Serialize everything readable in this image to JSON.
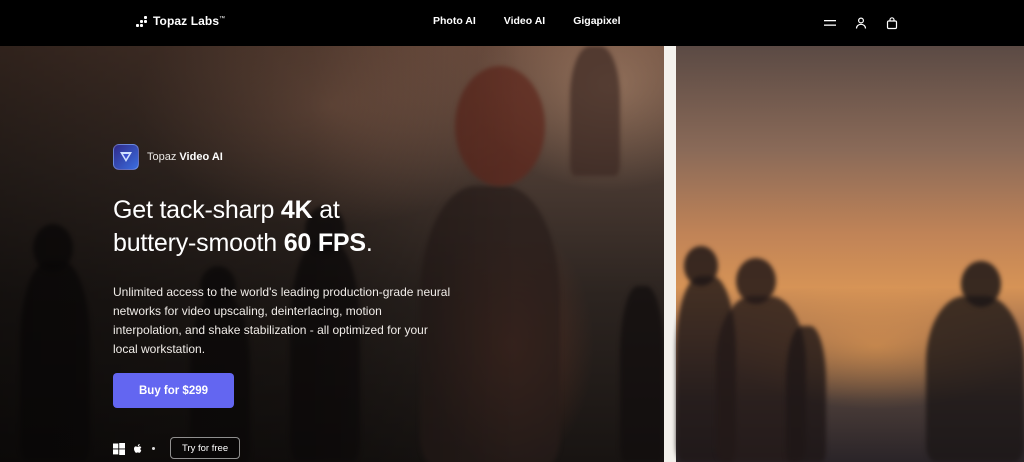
{
  "nav": {
    "brand": "Topaz Labs",
    "brand_tm": "™",
    "links": [
      "Photo AI",
      "Video AI",
      "Gigapixel"
    ],
    "icons": [
      "menu-icon",
      "user-icon",
      "shopping-bag-icon"
    ]
  },
  "hero": {
    "product_prefix": "Topaz",
    "product_name": "Video AI",
    "headline": {
      "line1_pre": "Get tack-sharp ",
      "line1_bold": "4K",
      "line1_post": " at",
      "line2_pre": "buttery-smooth ",
      "line2_bold": "60 FPS",
      "line2_post": "."
    },
    "description": "Unlimited access to the world's leading production-grade neural networks for video upscaling, deinterlacing, motion interpolation, and shake stabilization - all optimized for your local workstation.",
    "buy_label": "Buy for $299",
    "try_label": "Try for free",
    "platform_icons": [
      "windows-icon",
      "apple-icon"
    ]
  },
  "colors": {
    "accent": "#6366f1",
    "nav_bg": "#000000",
    "split_bar": "#f4f1ec"
  }
}
